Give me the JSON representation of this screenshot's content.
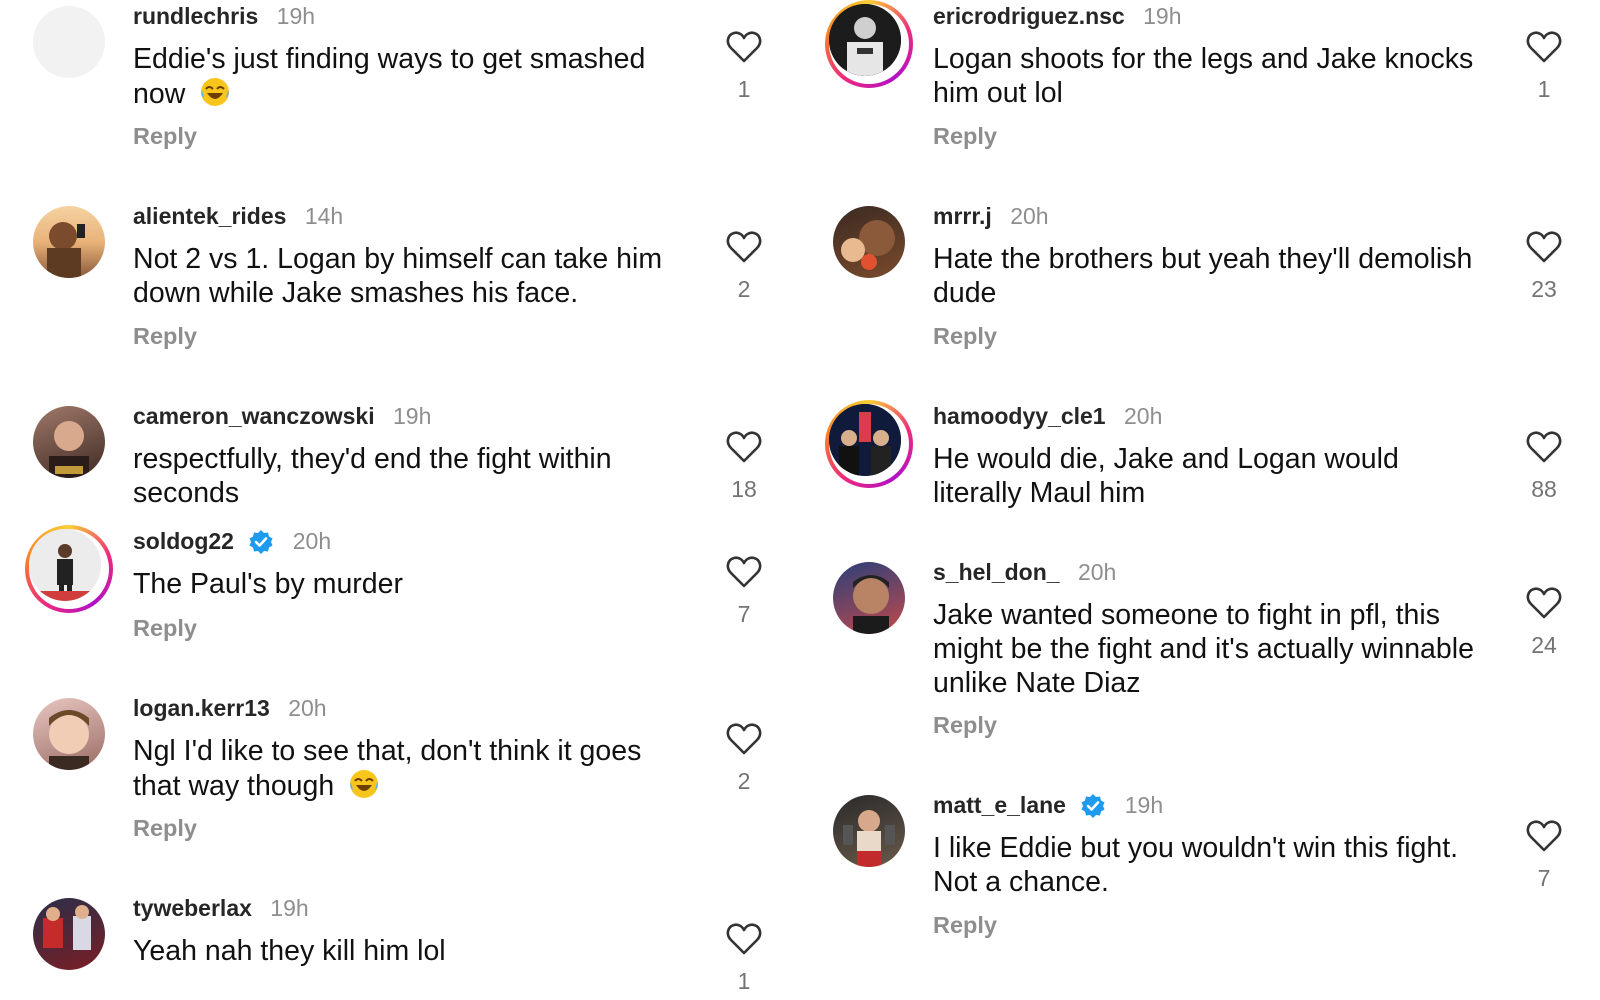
{
  "reply_label": "Reply",
  "colors": {
    "verified": "#1d9bf0",
    "story_ring": "#ee2a7b"
  },
  "left_comments": [
    {
      "username": "rundlechris",
      "time": "19h",
      "text": "Eddie's just finding ways to get smashed now",
      "emoji": "😂",
      "likes": "1"
    },
    {
      "username": "alientek_rides",
      "time": "14h",
      "text": "Not 2 vs 1. Logan by himself can take him down while Jake smashes his face.",
      "likes": "2"
    },
    {
      "username": "cameron_wanczowski",
      "time": "19h",
      "text": "respectfully, they'd end the fight within seconds",
      "likes": "18"
    },
    {
      "username": "soldog22",
      "time": "20h",
      "text": "The Paul's by murder",
      "likes": "7",
      "verified": true
    },
    {
      "username": "logan.kerr13",
      "time": "20h",
      "text": "Ngl I'd like to see that, don't think it goes that way though",
      "emoji": "😂",
      "likes": "2"
    },
    {
      "username": "tyweberlax",
      "time": "19h",
      "text": "Yeah nah they kill him lol",
      "likes": "1"
    }
  ],
  "right_comments": [
    {
      "username": "ericrodriguez.nsc",
      "time": "19h",
      "text": "Logan shoots for the legs and Jake knocks him out lol",
      "likes": "1"
    },
    {
      "username": "mrrr.j",
      "time": "20h",
      "text": "Hate the brothers but yeah they'll demolish dude",
      "likes": "23"
    },
    {
      "username": "hamoodyy_cle1",
      "time": "20h",
      "text": "He would die, Jake and Logan would literally Maul him",
      "likes": "88"
    },
    {
      "username": "s_hel_don_",
      "time": "20h",
      "text": "Jake wanted someone to fight in pfl, this might be the fight and it's actually winnable unlike Nate Diaz",
      "likes": "24"
    },
    {
      "username": "matt_e_lane",
      "time": "19h",
      "text": "I like Eddie but you wouldn't win this fight. Not a chance.",
      "likes": "7",
      "verified": true
    }
  ]
}
